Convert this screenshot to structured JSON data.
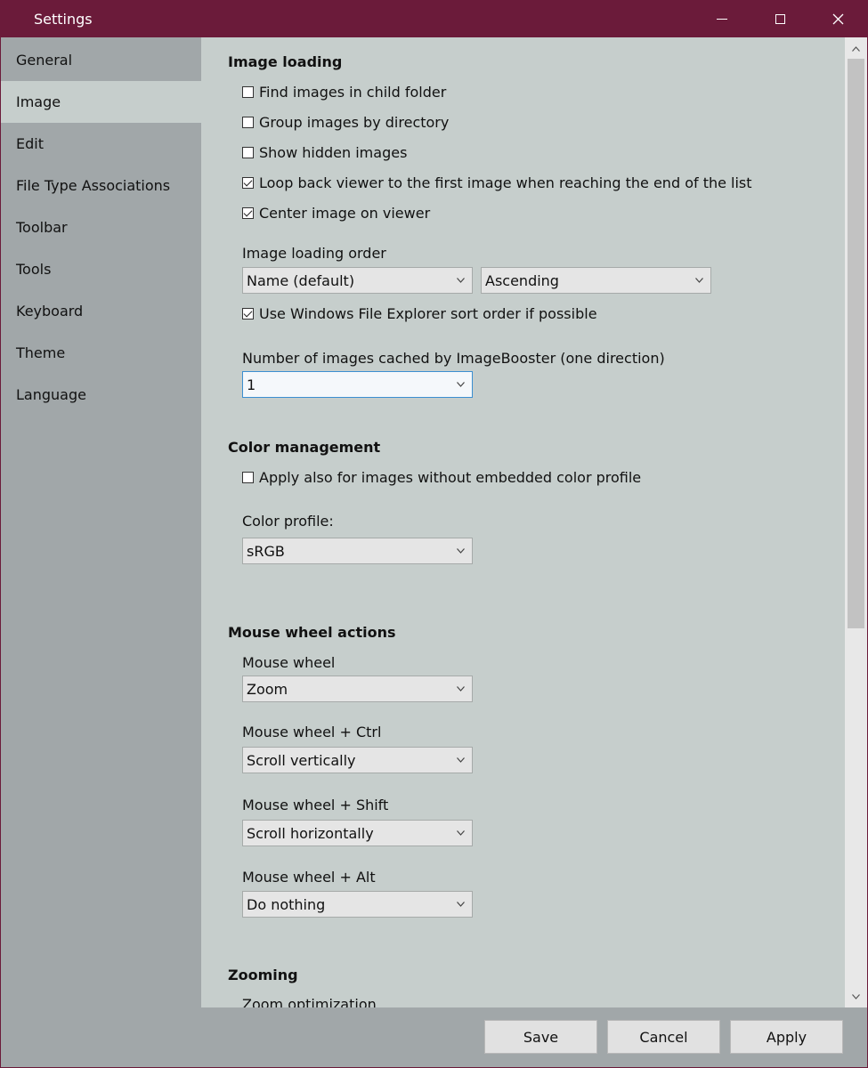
{
  "window": {
    "title": "Settings"
  },
  "sidebar": {
    "items": [
      {
        "label": "General"
      },
      {
        "label": "Image",
        "active": true
      },
      {
        "label": "Edit"
      },
      {
        "label": "File Type Associations"
      },
      {
        "label": "Toolbar"
      },
      {
        "label": "Tools"
      },
      {
        "label": "Keyboard"
      },
      {
        "label": "Theme"
      },
      {
        "label": "Language"
      }
    ]
  },
  "image_loading": {
    "title": "Image loading",
    "options": [
      {
        "label": "Find images in child folder",
        "checked": false
      },
      {
        "label": "Group images by directory",
        "checked": false
      },
      {
        "label": "Show hidden images",
        "checked": false
      },
      {
        "label": "Loop back viewer to the first image when reaching the end of the list",
        "checked": true
      },
      {
        "label": "Center image on viewer",
        "checked": true
      }
    ],
    "order_label": "Image loading order",
    "order_value": "Name (default)",
    "direction_value": "Ascending",
    "explorer_sort": {
      "label": "Use Windows File Explorer sort order if possible",
      "checked": true
    },
    "cache_label": "Number of images cached by ImageBooster (one direction)",
    "cache_value": "1"
  },
  "color_management": {
    "title": "Color management",
    "apply_option": {
      "label": "Apply also for images without embedded color profile",
      "checked": false
    },
    "profile_label": "Color profile:",
    "profile_value": "sRGB"
  },
  "mouse_wheel": {
    "title": "Mouse wheel actions",
    "wheel_label": "Mouse wheel",
    "wheel_value": "Zoom",
    "ctrl_label": "Mouse wheel + Ctrl",
    "ctrl_value": "Scroll vertically",
    "shift_label": "Mouse wheel + Shift",
    "shift_value": "Scroll horizontally",
    "alt_label": "Mouse wheel + Alt",
    "alt_value": "Do nothing"
  },
  "zooming": {
    "title": "Zooming",
    "optimization_label": "Zoom optimization"
  },
  "footer": {
    "save_label": "Save",
    "cancel_label": "Cancel",
    "apply_label": "Apply"
  },
  "colors": {
    "titlebar": "#6b1b3a",
    "sidebar": "#a1a7a9",
    "content": "#c6cecc",
    "focus_border": "#3c8fd1"
  }
}
